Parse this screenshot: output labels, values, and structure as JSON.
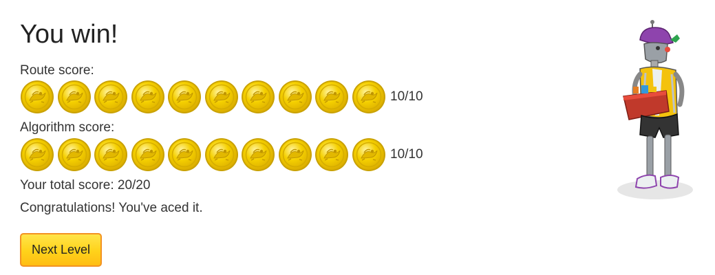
{
  "result": {
    "title": "You win!",
    "route_label": "Route score:",
    "route_score": "10/10",
    "route_coins": 10,
    "algorithm_label": "Algorithm score:",
    "algorithm_score": "10/10",
    "algorithm_coins": 10,
    "total_score": "Your total score: 20/20",
    "message": "Congratulations! You've aced it.",
    "next_button": "Next Level"
  },
  "icons": {
    "coin": "gold-coin-icon",
    "character": "robot-character-illustration"
  },
  "colors": {
    "coin_gold": "#f5d000",
    "coin_edge": "#c9a100",
    "button_fill": "#ffd21a",
    "button_border": "#f39221"
  }
}
